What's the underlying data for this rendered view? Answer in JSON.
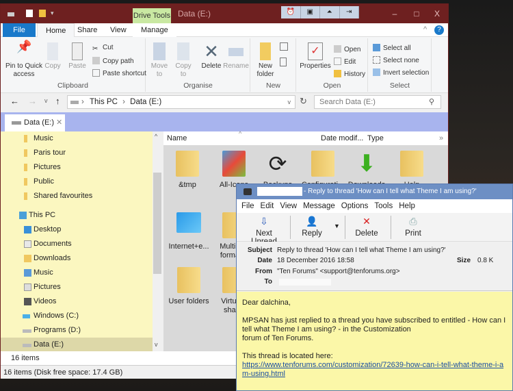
{
  "explorer": {
    "title": "Data (E:)",
    "context_tab": "Drive Tools",
    "window_buttons": {
      "minimize": "–",
      "maximize": "□",
      "close": "X"
    },
    "ribbon_tabs": [
      "File",
      "Home",
      "Share",
      "View",
      "Manage"
    ],
    "clipboard": {
      "pin": "Pin to Quick access",
      "copy": "Copy",
      "paste": "Paste",
      "cut": "Cut",
      "copy_path": "Copy path",
      "paste_shortcut": "Paste shortcut",
      "label": "Clipboard"
    },
    "organise": {
      "move_to": "Move to",
      "copy_to": "Copy to",
      "delete": "Delete",
      "rename": "Rename",
      "label": "Organise"
    },
    "new": {
      "new_folder": "New folder",
      "label": "New"
    },
    "open": {
      "properties": "Properties",
      "open": "Open",
      "edit": "Edit",
      "history": "History",
      "label": "Open"
    },
    "select": {
      "select_all": "Select all",
      "select_none": "Select none",
      "invert": "Invert selection",
      "label": "Select"
    },
    "address": {
      "this_pc": "This PC",
      "drive": "Data (E:)",
      "search_placeholder": "Search Data (E:)"
    },
    "doc_tab": "Data (E:)",
    "nav": [
      "Music",
      "Paris tour",
      "Pictures",
      "Public",
      "Shared favourites",
      "This PC",
      "Desktop",
      "Documents",
      "Downloads",
      "Music",
      "Pictures",
      "Videos",
      "Windows (C:)",
      "Programs (D:)",
      "Data (E:)"
    ],
    "columns": {
      "name": "Name",
      "date": "Date modif...",
      "type": "Type"
    },
    "files": [
      "&tmp",
      "All-Icons",
      "Backups",
      "Configurati...",
      "Downloads",
      "Help",
      "Internet+e...",
      "Multim... format...",
      "User folders",
      "Virtua... shar..."
    ],
    "status_items": "16 items",
    "status_bar": "16 items (Disk free space: 17.4 GB)"
  },
  "mail": {
    "title": "- Reply to thread 'How can I tell what Theme I am using?'",
    "menu": [
      "File",
      "Edit",
      "View",
      "Message",
      "Options",
      "Tools",
      "Help"
    ],
    "toolbar": {
      "next_unread": "Next Unread",
      "reply": "Reply",
      "delete": "Delete",
      "print": "Print"
    },
    "headers": {
      "subject_label": "Subject",
      "subject": "Reply to thread 'How can I tell what Theme I am using?'",
      "date_label": "Date",
      "date": "18 December 2016 18:58",
      "size_label": "Size",
      "size": "0.8 K",
      "from_label": "From",
      "from": "\"Ten Forums\" <support@tenforums.org>",
      "to_label": "To"
    },
    "body": {
      "greeting": "Dear dalchina,",
      "line1": "MPSAN has just replied to a thread you have subscribed to entitled -  How can I tell what Theme I am using? - in the Customization",
      "line2": "forum of Ten Forums.",
      "line3": "This thread is located here:",
      "link": "https://www.tenforums.com/customization/72639-how-can-i-tell-what-theme-i-am-using.html"
    }
  }
}
